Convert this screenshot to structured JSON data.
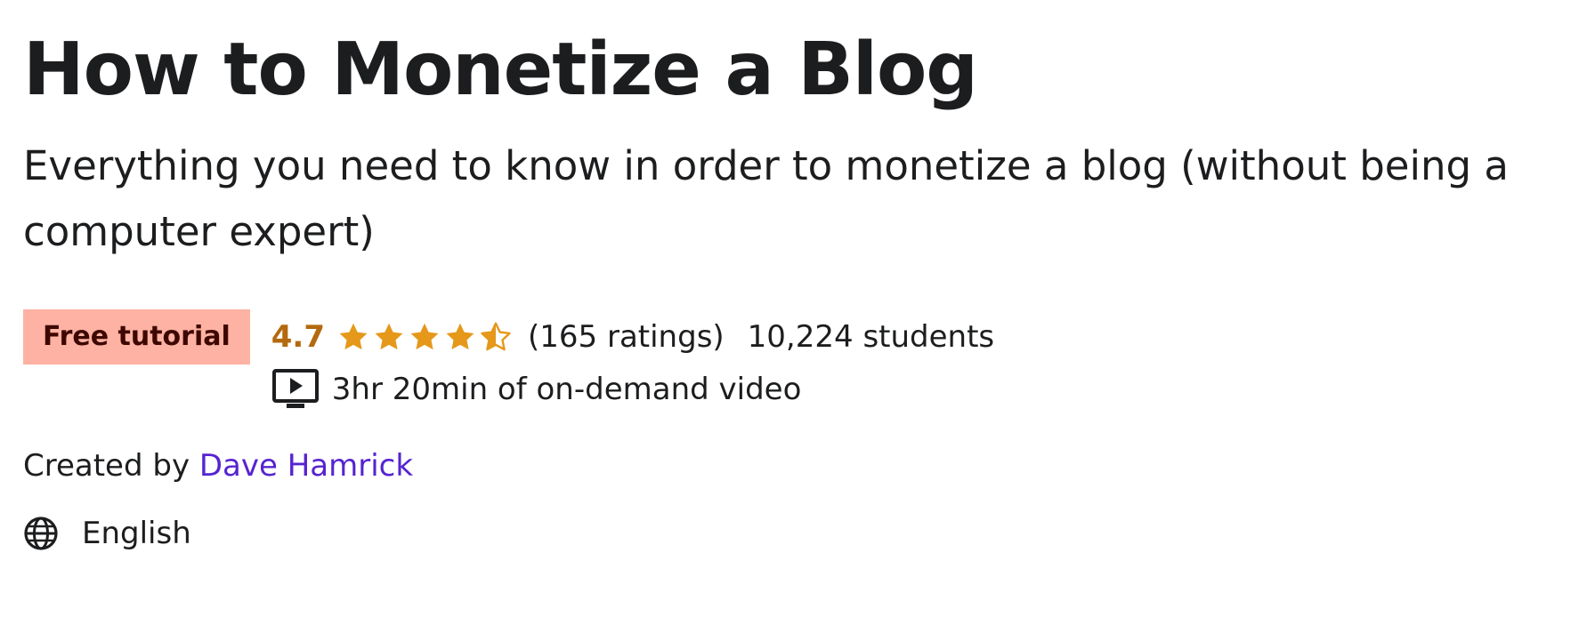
{
  "course": {
    "title": "How to Monetize a Blog",
    "subtitle": "Everything you need to know in order to monetize a blog (without being a computer expert)",
    "badge": "Free tutorial",
    "rating": "4.7",
    "rating_value": 4.7,
    "stars_max": 5,
    "ratings_count": "(165 ratings)",
    "students": "10,224 students",
    "video_length": "3hr 20min of on-demand video",
    "created_by_label": "Created by",
    "author": "Dave Hamrick",
    "language": "English"
  },
  "icons": {
    "star": "star-icon",
    "half_star": "half-star-icon",
    "video": "video-play-icon",
    "globe": "globe-icon"
  },
  "colors": {
    "badge_bg": "#feb2a3",
    "badge_text": "#3d0801",
    "rating": "#b4690e",
    "star": "#e59819",
    "link": "#5624d0",
    "text": "#1c1d1f"
  }
}
